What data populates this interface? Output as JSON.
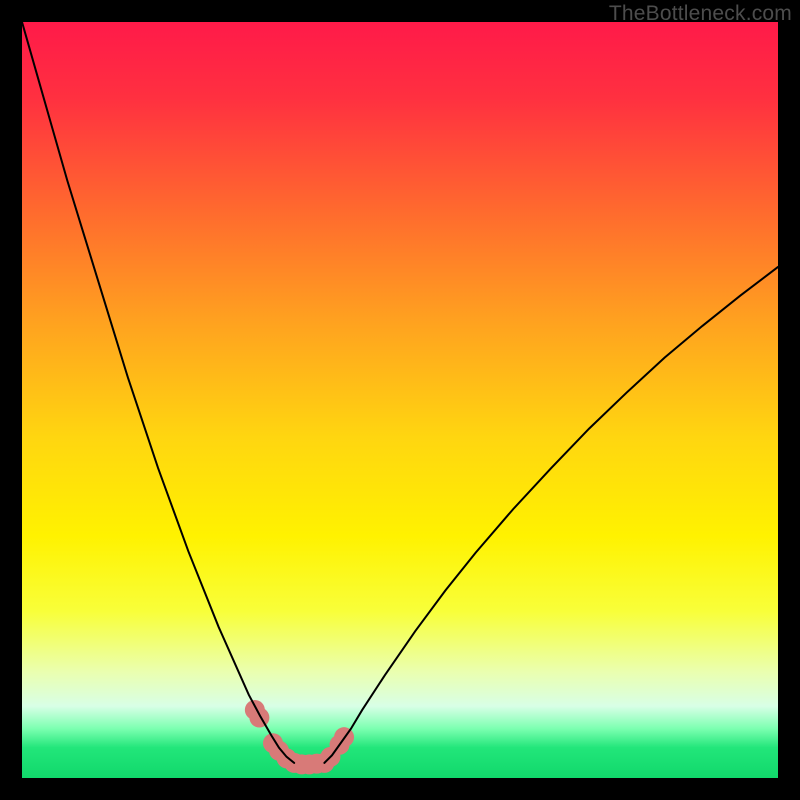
{
  "watermark": "TheBottleneck.com",
  "chart_data": {
    "type": "line",
    "title": "",
    "xlabel": "",
    "ylabel": "",
    "xlim": [
      0,
      100
    ],
    "ylim": [
      0,
      100
    ],
    "grid": false,
    "legend": false,
    "background_gradient_stops": [
      {
        "offset": 0.0,
        "color": "#ff1a49"
      },
      {
        "offset": 0.1,
        "color": "#ff3040"
      },
      {
        "offset": 0.25,
        "color": "#ff6a2e"
      },
      {
        "offset": 0.4,
        "color": "#ffa31f"
      },
      {
        "offset": 0.55,
        "color": "#ffd610"
      },
      {
        "offset": 0.68,
        "color": "#fff200"
      },
      {
        "offset": 0.78,
        "color": "#f8ff3a"
      },
      {
        "offset": 0.86,
        "color": "#eaffb0"
      },
      {
        "offset": 0.905,
        "color": "#d8ffe6"
      },
      {
        "offset": 0.935,
        "color": "#7bffb0"
      },
      {
        "offset": 0.96,
        "color": "#22e67a"
      },
      {
        "offset": 1.0,
        "color": "#11d86b"
      }
    ],
    "series": [
      {
        "name": "curve-left",
        "color": "#000000",
        "width": 2,
        "x": [
          0,
          2,
          4,
          6,
          8,
          10,
          12,
          14,
          16,
          18,
          20,
          22,
          24,
          26,
          28,
          30,
          31.5,
          33,
          34,
          35,
          36
        ],
        "y": [
          100,
          93,
          86,
          79,
          72.5,
          66,
          59.5,
          53,
          47,
          41,
          35.5,
          30,
          25,
          20,
          15.5,
          11,
          8.2,
          5.6,
          4.0,
          2.8,
          2.0
        ]
      },
      {
        "name": "curve-right",
        "color": "#000000",
        "width": 2,
        "x": [
          40,
          41,
          42,
          43.5,
          45,
          48,
          52,
          56,
          60,
          65,
          70,
          75,
          80,
          85,
          90,
          95,
          100
        ],
        "y": [
          2.0,
          3.0,
          4.4,
          6.5,
          9.0,
          13.6,
          19.4,
          24.8,
          29.8,
          35.6,
          41.0,
          46.2,
          51.0,
          55.6,
          59.8,
          63.8,
          67.6
        ]
      },
      {
        "name": "marker-band",
        "type": "scatter",
        "color": "#d87a78",
        "radius": 10,
        "x": [
          30.8,
          31.4,
          33.2,
          34.0,
          35.0,
          36.0,
          37.0,
          38.0,
          39.0,
          40.0,
          40.8,
          42.0,
          42.6
        ],
        "y": [
          9.0,
          8.0,
          4.6,
          3.6,
          2.6,
          2.0,
          1.8,
          1.8,
          1.9,
          2.0,
          2.8,
          4.4,
          5.4
        ]
      }
    ]
  }
}
